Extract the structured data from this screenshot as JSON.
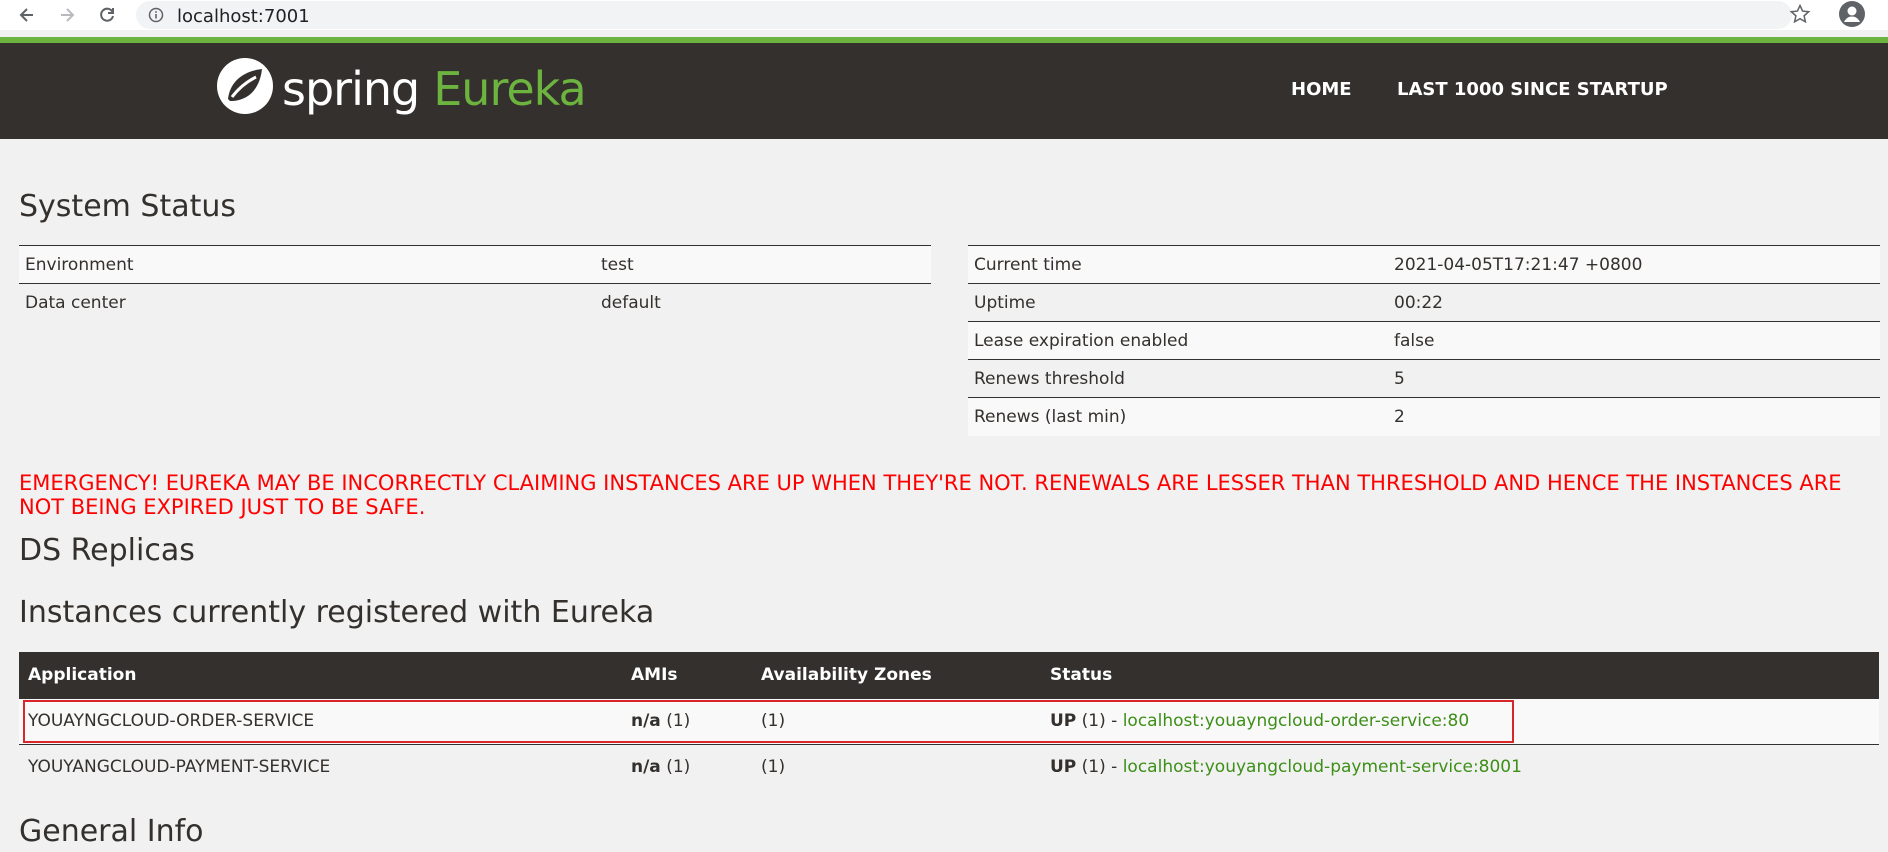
{
  "browser": {
    "url": "localhost:7001"
  },
  "header": {
    "logo_spring": "spring",
    "logo_eureka": "Eureka",
    "nav": [
      "HOME",
      "LAST 1000 SINCE STARTUP"
    ]
  },
  "system_status": {
    "title": "System Status",
    "left_table": [
      {
        "key": "Environment",
        "value": "test"
      },
      {
        "key": "Data center",
        "value": "default"
      }
    ],
    "right_table": [
      {
        "key": "Current time",
        "value": "2021-04-05T17:21:47 +0800"
      },
      {
        "key": "Uptime",
        "value": "00:22"
      },
      {
        "key": "Lease expiration enabled",
        "value": "false"
      },
      {
        "key": "Renews threshold",
        "value": "5"
      },
      {
        "key": "Renews (last min)",
        "value": "2"
      }
    ]
  },
  "emergency": "EMERGENCY! EUREKA MAY BE INCORRECTLY CLAIMING INSTANCES ARE UP WHEN THEY'RE NOT. RENEWALS ARE LESSER THAN THRESHOLD AND HENCE THE INSTANCES ARE NOT BEING EXPIRED JUST TO BE SAFE.",
  "ds_replicas_title": "DS Replicas",
  "instances": {
    "title": "Instances currently registered with Eureka",
    "columns": [
      "Application",
      "AMIs",
      "Availability Zones",
      "Status"
    ],
    "rows": [
      {
        "application": "YOUAYNGCLOUD-ORDER-SERVICE",
        "amis_bold": "n/a",
        "amis_count": " (1)",
        "zones": "(1)",
        "status_bold": "UP",
        "status_rest": " (1) - ",
        "link": "localhost:youayngcloud-order-service:80"
      },
      {
        "application": "YOUYANGCLOUD-PAYMENT-SERVICE",
        "amis_bold": "n/a",
        "amis_count": " (1)",
        "zones": "(1)",
        "status_bold": "UP",
        "status_rest": " (1) - ",
        "link": "localhost:youyangcloud-payment-service:8001"
      }
    ]
  },
  "general_info_title": "General Info",
  "colors": {
    "header_bg": "#34302d",
    "brand_green": "#6db33f",
    "link_green": "#3d8f18",
    "emergency_red": "#ff0000",
    "highlight_red": "#d9262b"
  }
}
